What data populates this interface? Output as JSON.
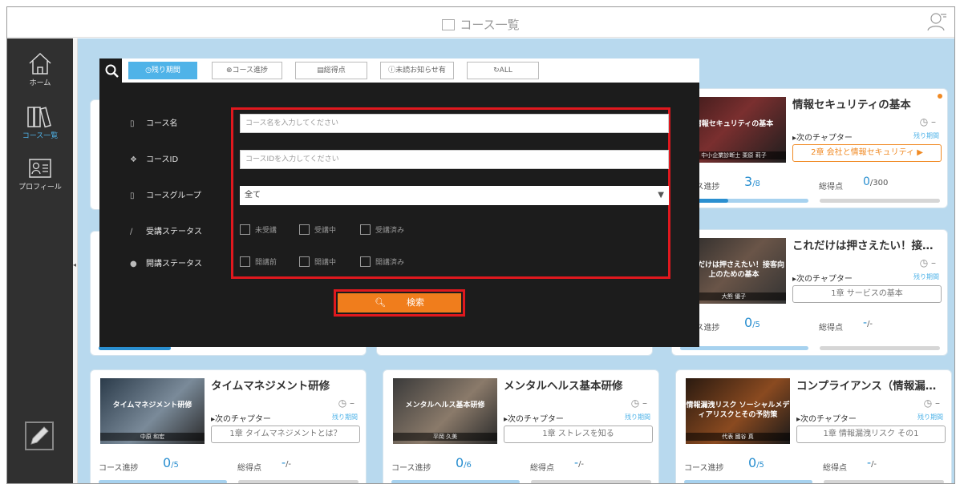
{
  "header": {
    "title": "コース一覧",
    "icon": "book-icon",
    "user_icon": "user-icon"
  },
  "sidebar": {
    "items": [
      {
        "label": "ホーム",
        "icon": "home-icon"
      },
      {
        "label": "コース一覧",
        "icon": "books-icon"
      },
      {
        "label": "プロフィール",
        "icon": "profile-card-icon"
      }
    ],
    "bottom_icon": "pencil-icon"
  },
  "filters": {
    "buttons": [
      {
        "label": "残り期間",
        "icon": "clock-icon",
        "active": true
      },
      {
        "label": "コース進捗",
        "icon": "progress-icon",
        "active": false
      },
      {
        "label": "総得点",
        "icon": "score-icon",
        "active": false
      },
      {
        "label": "未読お知らせ有",
        "icon": "info-icon",
        "active": false
      },
      {
        "label": "ALL",
        "icon": "refresh-icon",
        "active": false
      }
    ]
  },
  "search_panel": {
    "course_name_label": "コース名",
    "course_name_placeholder": "コース名を入力してください",
    "course_id_label": "コースID",
    "course_id_placeholder": "コースIDを入力してください",
    "group_label": "コースグループ",
    "group_value": "全て",
    "attend_status_label": "受講ステータス",
    "attend_options": [
      "未受講",
      "受講中",
      "受講済み"
    ],
    "open_status_label": "開講ステータス",
    "open_options": [
      "開講前",
      "開講中",
      "開講済み"
    ],
    "search_button": "検索"
  },
  "cards": [
    {
      "title": "情報セキュリティの基本",
      "thumb_title": "情報セキュリティの基本",
      "thumb_sub": "中小企業診断士 栗原 莉子",
      "next_label": "次のチャプター",
      "remaining_label": "残り期間",
      "chapter": "2章 会社と情報セキュリティ",
      "progress_label": "コース進捗",
      "progress": "3",
      "progress_total": "/8",
      "progress_fraction": 0.375,
      "score_label": "総得点",
      "score": "0",
      "score_total": "/300",
      "clock_text": "–",
      "accent_chapter": true
    },
    {
      "title": "これだけは押さえたい！接…",
      "thumb_title": "これだけは押さえたい！接客向上のための基本",
      "thumb_sub": "大熊 優子",
      "next_label": "次のチャプター",
      "remaining_label": "残り期間",
      "chapter": "1章 サービスの基本",
      "progress_label": "コース進捗",
      "progress": "0",
      "progress_total": "/5",
      "progress_fraction": 0,
      "score_label": "総得点",
      "score": "-",
      "score_total": "/-",
      "clock_text": "–",
      "accent_chapter": false
    },
    {
      "title": "タイムマネジメント研修",
      "thumb_title": "タイムマネジメント研修",
      "thumb_sub": "中原 和宏",
      "next_label": "次のチャプター",
      "remaining_label": "残り期間",
      "chapter": "1章 タイムマネジメントとは？",
      "progress_label": "コース進捗",
      "progress": "0",
      "progress_total": "/5",
      "progress_fraction": 0,
      "score_label": "総得点",
      "score": "-",
      "score_total": "/-",
      "clock_text": "–",
      "accent_chapter": false
    },
    {
      "title": "メンタルヘルス基本研修",
      "thumb_title": "メンタルヘルス基本研修",
      "thumb_sub": "平岡 久美",
      "next_label": "次のチャプター",
      "remaining_label": "残り期間",
      "chapter": "1章 ストレスを知る",
      "progress_label": "コース進捗",
      "progress": "0",
      "progress_total": "/6",
      "progress_fraction": 0,
      "score_label": "総得点",
      "score": "-",
      "score_total": "/-",
      "clock_text": "–",
      "accent_chapter": false
    },
    {
      "title": "コンプライアンス（情報漏…",
      "thumb_title": "情報漏洩リスク ソーシャルメディアリスクとその予防策",
      "thumb_sub": "代表 國谷 真",
      "next_label": "次のチャプター",
      "remaining_label": "残り期間",
      "chapter": "1章 情報漏洩リスク その1",
      "progress_label": "コース進捗",
      "progress": "0",
      "progress_total": "/5",
      "progress_fraction": 0,
      "score_label": "総得点",
      "score": "-",
      "score_total": "/-",
      "clock_text": "–",
      "accent_chapter": false
    }
  ],
  "colors": {
    "accent": "#4fb3e8",
    "orange": "#f07d1c",
    "highlight_red": "#e0181e",
    "sidebar": "#303030"
  }
}
